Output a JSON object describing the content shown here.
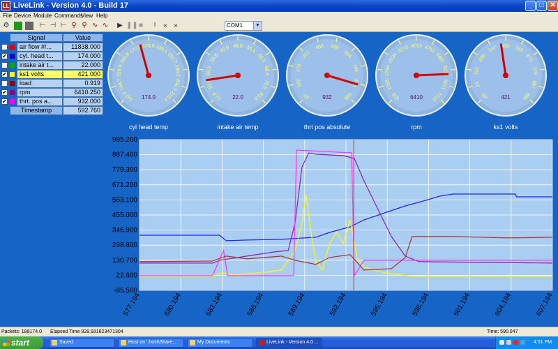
{
  "window": {
    "title": "LiveLink - Version 4.0 - Build 17",
    "app_icon_text": "LL"
  },
  "menu": [
    "File",
    "Device",
    "Module",
    "Commands",
    "View",
    "Help"
  ],
  "toolbar": {
    "icons": [
      "wizard-icon",
      "green-record-icon",
      "stop-icon",
      "step-back-icon",
      "step-forward-icon",
      "probe-icon",
      "probe2-icon",
      "wave-icon",
      "wave2-icon",
      "play-icon",
      "pause-icon",
      "stop2-icon",
      "marker-icon",
      "rewind-icon",
      "fast-forward-icon"
    ],
    "com_port": "COM1"
  },
  "signals": {
    "header_signal": "Signal",
    "header_value": "Value",
    "rows": [
      {
        "name": "air flow #/...",
        "value": "11838.000",
        "color": "#dd0000",
        "checked": false
      },
      {
        "name": "cyl. head t...",
        "value": "174.000",
        "color": "#0000cc",
        "checked": true
      },
      {
        "name": "intake air t...",
        "value": "22.000",
        "color": "#00aa00",
        "checked": false
      },
      {
        "name": "ks1 volts",
        "value": "421.000",
        "color": "#ffff00",
        "checked": true
      },
      {
        "name": "load",
        "value": "0.919",
        "color": "#880000",
        "checked": false
      },
      {
        "name": "rpm",
        "value": "6410.250",
        "color": "#880088",
        "checked": true
      },
      {
        "name": "thrt. pos a...",
        "value": "932.000",
        "color": "#ff00ff",
        "checked": true
      }
    ],
    "timestamp_label": "Timestamp",
    "timestamp_value": "592.760"
  },
  "gauges": [
    {
      "label": "cyl head temp",
      "ticks": [
        "142.6",
        "149.7",
        "156.8",
        "163.8",
        "170.9",
        "178.0",
        "185.1",
        "192.2",
        "199.2",
        "206.3",
        "213.4"
      ],
      "value": "174.0",
      "min": 142.6,
      "max": 213.4,
      "reading": 174
    },
    {
      "label": "intake air temp",
      "ticks": [
        "12.4",
        "19.5",
        "26.6",
        "33.8",
        "40.9",
        "48.0",
        "55.1",
        "62.2",
        "69.4",
        "76.5",
        "83.6"
      ],
      "value": "22.0",
      "min": 12.4,
      "max": 83.6,
      "reading": 22
    },
    {
      "label": "thrt pos absolute",
      "ticks": [
        "87",
        "182",
        "276",
        "371",
        "465",
        "560",
        "654",
        "749",
        "843",
        "938"
      ],
      "value": "932",
      "min": 87,
      "max": 1032,
      "reading": 932
    },
    {
      "label": "rpm",
      "ticks": [
        "316",
        "1055",
        "1794",
        "2534",
        "3273",
        "4013",
        "4752",
        "5492",
        "6231",
        "6971",
        "7710"
      ],
      "value": "6410",
      "min": 316,
      "max": 7710,
      "reading": 6410
    },
    {
      "label": "ks1 volts",
      "ticks": [
        "-85",
        "23",
        "131",
        "239",
        "347",
        "455",
        "563",
        "671",
        "779",
        "887",
        "995"
      ],
      "value": "421",
      "min": -85,
      "max": 995,
      "reading": 421
    }
  ],
  "plot": {
    "y_labels": [
      "995.200",
      "887.400",
      "779.300",
      "671.200",
      "563.100",
      "455.000",
      "346.900",
      "238.800",
      "130.700",
      "22.600",
      "-85.500"
    ],
    "x_labels": [
      "577.194",
      "580.194",
      "583.194",
      "586.194",
      "589.194",
      "592.194",
      "595.194",
      "598.194",
      "601.194",
      "604.194",
      "607.194"
    ]
  },
  "chart_data": {
    "type": "line",
    "title": "",
    "xlabel": "",
    "ylabel": "",
    "xlim": [
      577.194,
      607.194
    ],
    "ylim": [
      -85.5,
      995.2
    ],
    "grid": true,
    "cursor_x": 592.76,
    "series": [
      {
        "color": "#2222ee",
        "points": [
          [
            577.194,
            310
          ],
          [
            583.0,
            310
          ],
          [
            583.5,
            270
          ],
          [
            585.0,
            275
          ],
          [
            587.5,
            280
          ],
          [
            590.0,
            295
          ],
          [
            591.0,
            330
          ],
          [
            592.5,
            370
          ],
          [
            593.5,
            420
          ],
          [
            595.0,
            470
          ],
          [
            596.5,
            520
          ],
          [
            598.0,
            560
          ],
          [
            599.0,
            590
          ],
          [
            600.0,
            605
          ],
          [
            604.5,
            605
          ],
          [
            604.6,
            585
          ],
          [
            607.194,
            585
          ]
        ]
      },
      {
        "color": "#ffff00",
        "points": [
          [
            577.194,
            15
          ],
          [
            582.5,
            15
          ],
          [
            583.2,
            40
          ],
          [
            584.0,
            25
          ],
          [
            586.0,
            40
          ],
          [
            587.5,
            60
          ],
          [
            588.5,
            200
          ],
          [
            589.0,
            400
          ],
          [
            589.3,
            600
          ],
          [
            589.7,
            300
          ],
          [
            590.0,
            120
          ],
          [
            590.5,
            60
          ],
          [
            591.0,
            250
          ],
          [
            591.5,
            330
          ],
          [
            592.0,
            250
          ],
          [
            592.5,
            420
          ],
          [
            593.0,
            150
          ],
          [
            593.5,
            80
          ],
          [
            595.0,
            40
          ],
          [
            597.0,
            15
          ],
          [
            607.194,
            15
          ]
        ]
      },
      {
        "color": "#8822aa",
        "points": [
          [
            577.194,
            110
          ],
          [
            582.5,
            110
          ],
          [
            583.0,
            130
          ],
          [
            585.0,
            160
          ],
          [
            587.0,
            190
          ],
          [
            588.0,
            200
          ],
          [
            588.5,
            400
          ],
          [
            589.0,
            800
          ],
          [
            589.5,
            900
          ],
          [
            590.0,
            890
          ],
          [
            592.0,
            880
          ],
          [
            592.8,
            860
          ],
          [
            593.5,
            700
          ],
          [
            594.5,
            500
          ],
          [
            595.5,
            300
          ],
          [
            596.5,
            160
          ],
          [
            597.5,
            120
          ],
          [
            607.194,
            110
          ]
        ]
      },
      {
        "color": "#ff33ff",
        "points": [
          [
            577.194,
            20
          ],
          [
            582.5,
            20
          ],
          [
            583.3,
            200
          ],
          [
            583.6,
            20
          ],
          [
            588.4,
            20
          ],
          [
            588.6,
            920
          ],
          [
            592.6,
            900
          ],
          [
            592.8,
            20
          ],
          [
            593.5,
            130
          ],
          [
            595.0,
            130
          ],
          [
            607.194,
            130
          ]
        ]
      },
      {
        "color": "#aa3333",
        "points": [
          [
            577.194,
            120
          ],
          [
            582.5,
            125
          ],
          [
            583.5,
            160
          ],
          [
            585.0,
            140
          ],
          [
            587.5,
            160
          ],
          [
            588.5,
            130
          ],
          [
            590.0,
            100
          ],
          [
            591.0,
            150
          ],
          [
            592.5,
            170
          ],
          [
            593.5,
            60
          ],
          [
            595.5,
            70
          ],
          [
            596.5,
            150
          ],
          [
            597.0,
            300
          ],
          [
            600.0,
            300
          ],
          [
            604.0,
            290
          ],
          [
            607.194,
            295
          ]
        ]
      }
    ]
  },
  "status": {
    "packets": "Packets: 188174.0",
    "elapsed": "Elapsed Time 828.931623471304",
    "time": "Time: 590.047"
  },
  "taskbar": {
    "start": "start",
    "buttons": [
      "Saved",
      "Host on '.host\\Share...",
      "My Documents",
      "LiveLink - Version 4.0 ..."
    ],
    "clock": "4:51 PM"
  }
}
